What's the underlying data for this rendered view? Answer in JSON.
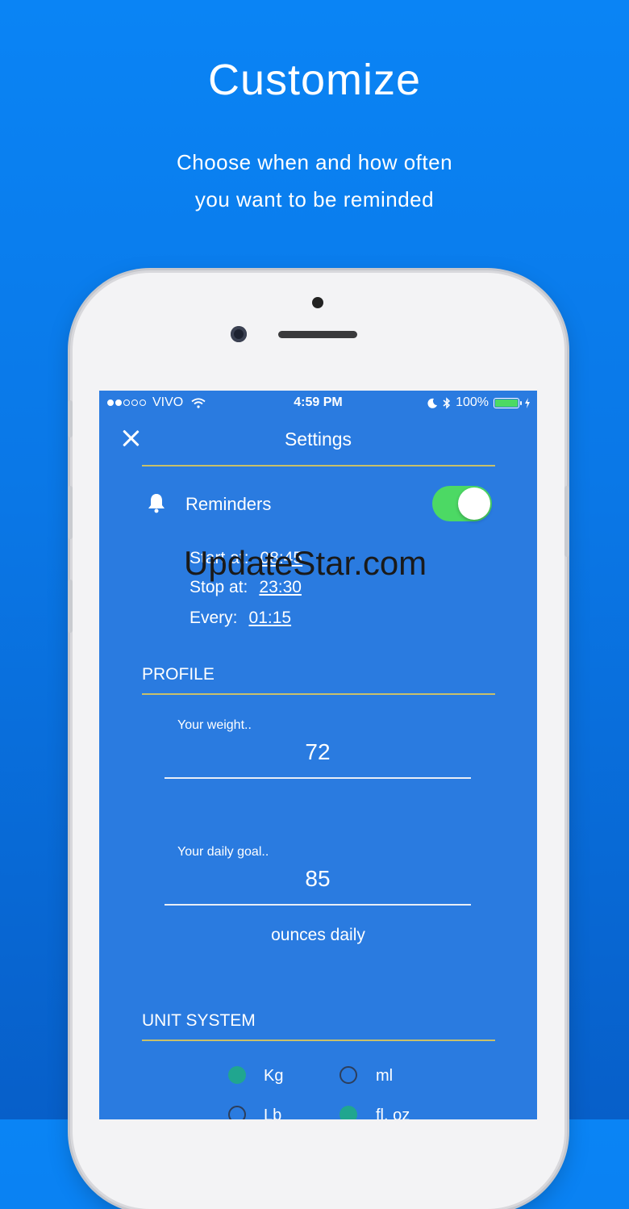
{
  "promo": {
    "headline": "Customize",
    "subline_1": "Choose when and how often",
    "subline_2": "you want to be reminded"
  },
  "status_bar": {
    "carrier": "VIVO",
    "time": "4:59 PM",
    "battery": "100%"
  },
  "header": {
    "title": "Settings"
  },
  "reminders": {
    "label": "Reminders",
    "enabled": true,
    "start_label": "Start at:",
    "start_value": "08:45",
    "stop_label": "Stop at:",
    "stop_value": "23:30",
    "every_label": "Every:",
    "every_value": "01:15"
  },
  "watermark": "UpdateStar.com",
  "profile": {
    "section_title": "PROFILE",
    "weight_label": "Your weight..",
    "weight_value": "72",
    "goal_label": "Your daily goal..",
    "goal_value": "85",
    "goal_units": "ounces daily"
  },
  "unit_system": {
    "section_title": "UNIT SYSTEM",
    "options": [
      {
        "label": "Kg",
        "selected": true
      },
      {
        "label": "ml",
        "selected": false
      },
      {
        "label": "Lb",
        "selected": false
      },
      {
        "label": "fl. oz",
        "selected": true
      }
    ]
  },
  "colors": {
    "background": "#0a84f5",
    "screen": "#2a7be0",
    "toggle_on": "#4cd964",
    "radio_selected": "#20a68f",
    "divider": "#c8c06a"
  }
}
